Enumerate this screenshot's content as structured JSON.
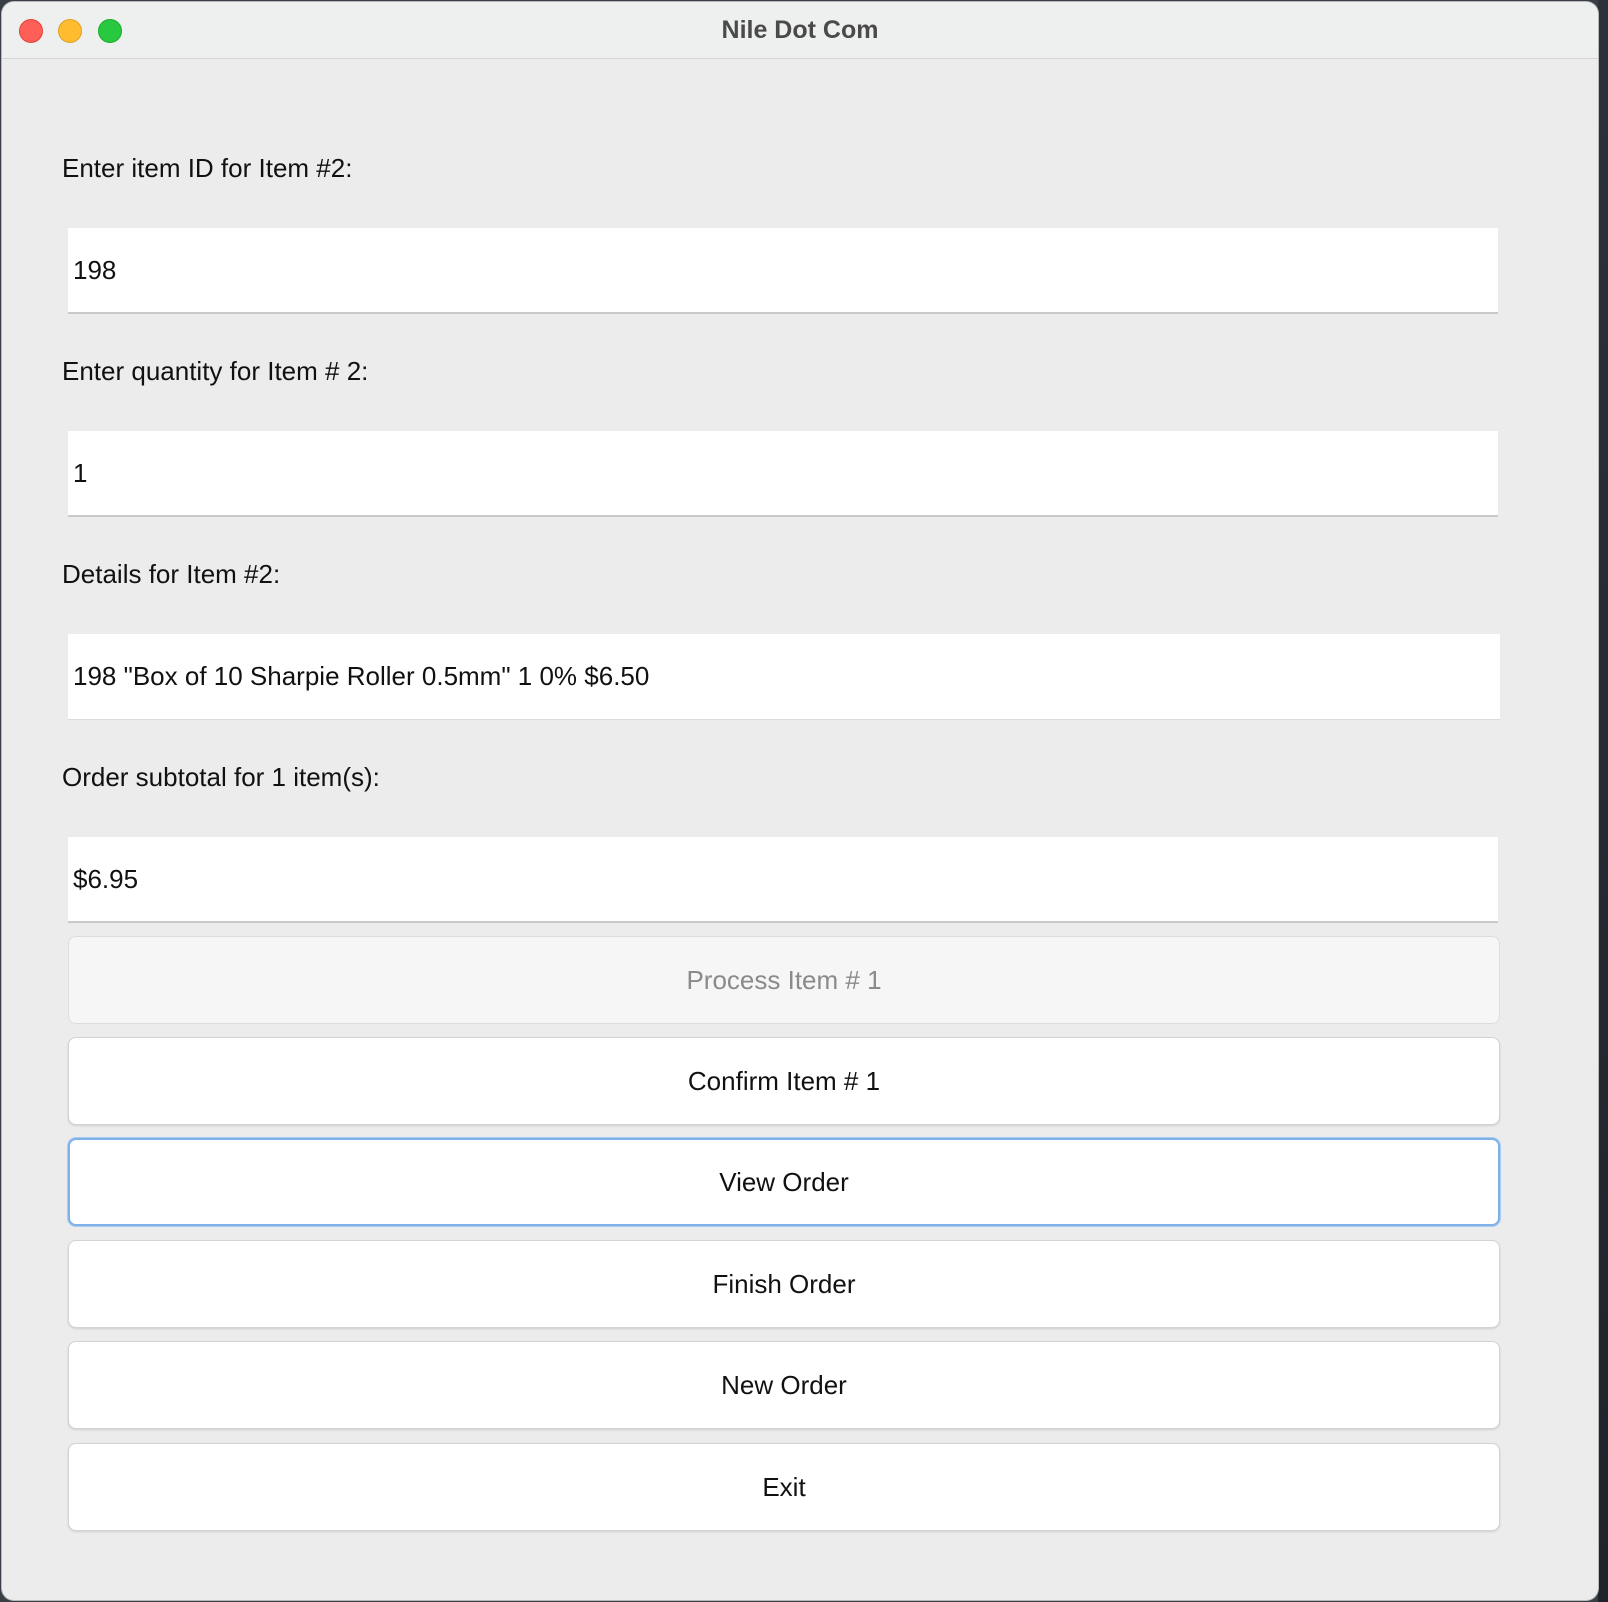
{
  "window": {
    "title": "Nile Dot Com"
  },
  "form": {
    "item_id_label": "Enter item ID for Item #2:",
    "item_id_value": "198",
    "quantity_label": "Enter quantity for Item # 2:",
    "quantity_value": "1",
    "details_label": "Details for Item #2:",
    "details_value": "198 \"Box of 10 Sharpie Roller 0.5mm\" 1 0% $6.50",
    "subtotal_label": "Order subtotal for 1 item(s):",
    "subtotal_value": "$6.95"
  },
  "buttons": {
    "process": "Process Item # 1",
    "confirm": "Confirm Item # 1",
    "view": "View Order",
    "finish": "Finish Order",
    "new": "New Order",
    "exit": "Exit"
  },
  "states": {
    "process_enabled": false,
    "focused_button": "View Order"
  },
  "colors": {
    "window_bg": "#ececec",
    "focus_ring": "#7fb0e6",
    "close": "#ff5f57",
    "minimize": "#febc2e",
    "zoom": "#28c840"
  }
}
